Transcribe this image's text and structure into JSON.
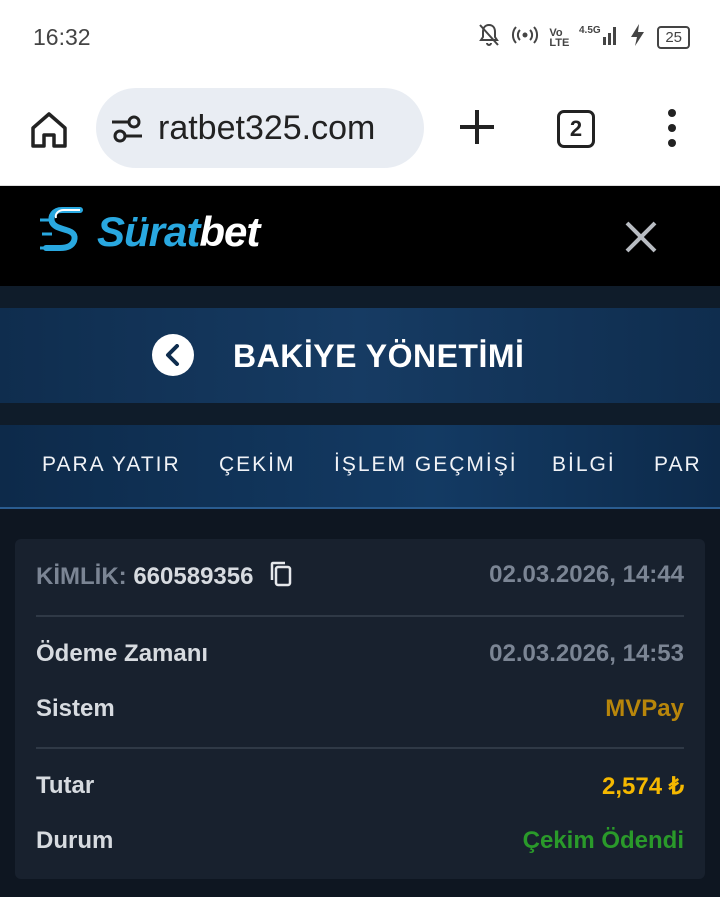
{
  "status_bar": {
    "time": "16:32",
    "battery": "25"
  },
  "browser": {
    "url": "ratbet325.com",
    "tab_count": "2"
  },
  "site": {
    "logo_part1": "Sürat",
    "logo_part2": "bet"
  },
  "page": {
    "title": "BAKİYE YÖNETİMİ"
  },
  "nav": {
    "items": [
      "PARA YATIR",
      "ÇEKİM",
      "İŞLEM GEÇMİŞİ",
      "BİLGİ",
      "PAR"
    ]
  },
  "transaction": {
    "id_label": "KİMLİK:",
    "id_value": "660589356",
    "created_at": "02.03.2026, 14:44",
    "payment_time_label": "Ödeme Zamanı",
    "payment_time_value": "02.03.2026, 14:53",
    "system_label": "Sistem",
    "system_value": "MVPay",
    "amount_label": "Tutar",
    "amount_value": "2,574 ₺",
    "status_label": "Durum",
    "status_value": "Çekim Ödendi"
  }
}
